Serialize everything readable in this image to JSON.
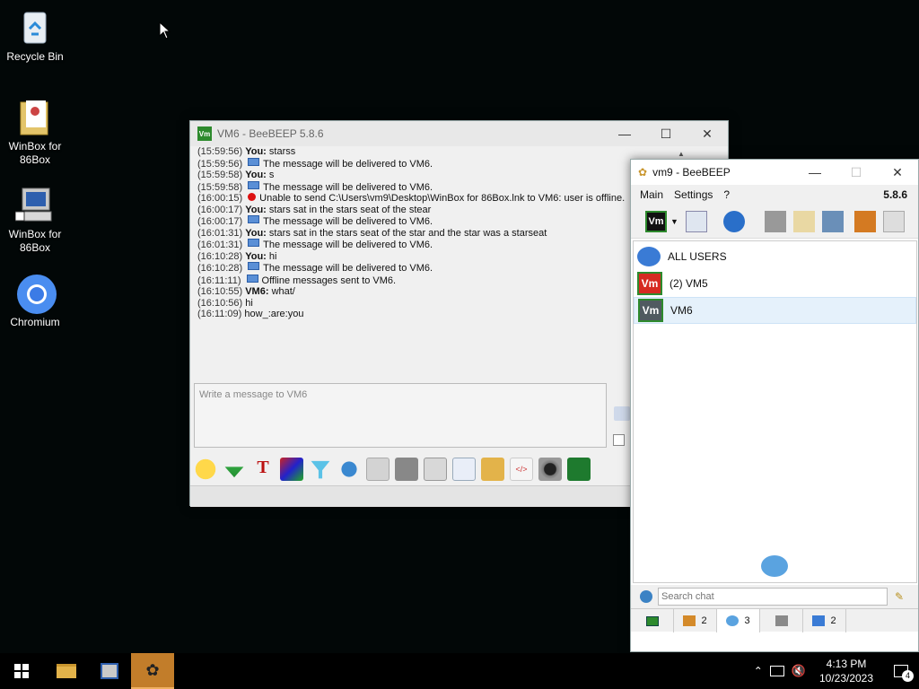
{
  "desktop": {
    "icons": [
      {
        "label": "Recycle Bin"
      },
      {
        "label": "WinBox for 86Box"
      },
      {
        "label": "WinBox for 86Box"
      },
      {
        "label": "Chromium"
      }
    ]
  },
  "chat_window": {
    "title": "VM6 - BeeBEEP 5.8.6",
    "icon_text": "Vm",
    "messages": [
      {
        "time": "(15:59:56)",
        "kind": "you",
        "speaker": "You:",
        "text": "starss"
      },
      {
        "time": "(15:59:56)",
        "kind": "system",
        "text": "The message will be delivered to VM6."
      },
      {
        "time": "(15:59:58)",
        "kind": "you",
        "speaker": "You:",
        "text": "s"
      },
      {
        "time": "(15:59:58)",
        "kind": "system",
        "text": "The message will be delivered to VM6."
      },
      {
        "time": "(16:00:15)",
        "kind": "error",
        "text": "Unable to send C:\\Users\\vm9\\Desktop\\WinBox for 86Box.lnk to VM6: user is offline."
      },
      {
        "time": "(16:00:17)",
        "kind": "you",
        "speaker": "You:",
        "text": "stars sat in the stars seat of the stear"
      },
      {
        "time": "(16:00:17)",
        "kind": "system",
        "text": "The message will be delivered to VM6."
      },
      {
        "time": "(16:01:31)",
        "kind": "you",
        "speaker": "You:",
        "text": "stars sat in the stars seat of the star and the star was a starseat"
      },
      {
        "time": "(16:01:31)",
        "kind": "system",
        "text": "The message will be delivered to VM6."
      },
      {
        "time": "(16:10:28)",
        "kind": "you",
        "speaker": "You:",
        "text": "hi"
      },
      {
        "time": "(16:10:28)",
        "kind": "system",
        "text": "The message will be delivered to VM6."
      },
      {
        "time": "(16:11:11)",
        "kind": "system",
        "text": "Offline messages sent to VM6."
      },
      {
        "time": "(16:10:55)",
        "kind": "vm6",
        "speaker": "VM6:",
        "text": "what/"
      },
      {
        "time": "(16:10:56)",
        "kind": "plain",
        "text": "hi"
      },
      {
        "time": "(16:11:09)",
        "kind": "plain",
        "text": "how_:are:you"
      }
    ],
    "input_placeholder": "Write a message to VM6"
  },
  "users_window": {
    "title": "vm9 - BeeBEEP",
    "menu": [
      "Main",
      "Settings",
      "?"
    ],
    "version": "5.8.6",
    "items": [
      {
        "label": "ALL USERS",
        "icon": "users-icon"
      },
      {
        "label": "(2) VM5",
        "icon_text": "Vm",
        "color": "#d62a21"
      },
      {
        "label": "VM6",
        "icon_text": "Vm",
        "color": "#505a60"
      }
    ],
    "search_placeholder": "Search chat",
    "tabs": [
      {
        "icon": "screen-icon",
        "count": ""
      },
      {
        "icon": "users-tab-icon",
        "count": "2"
      },
      {
        "icon": "chat-tab-icon",
        "count": "3"
      },
      {
        "icon": "groups-tab-icon",
        "count": ""
      },
      {
        "icon": "shares-tab-icon",
        "count": "2"
      }
    ]
  },
  "taskbar": {
    "time": "4:13 PM",
    "date": "10/23/2023",
    "notification_count": "4"
  }
}
